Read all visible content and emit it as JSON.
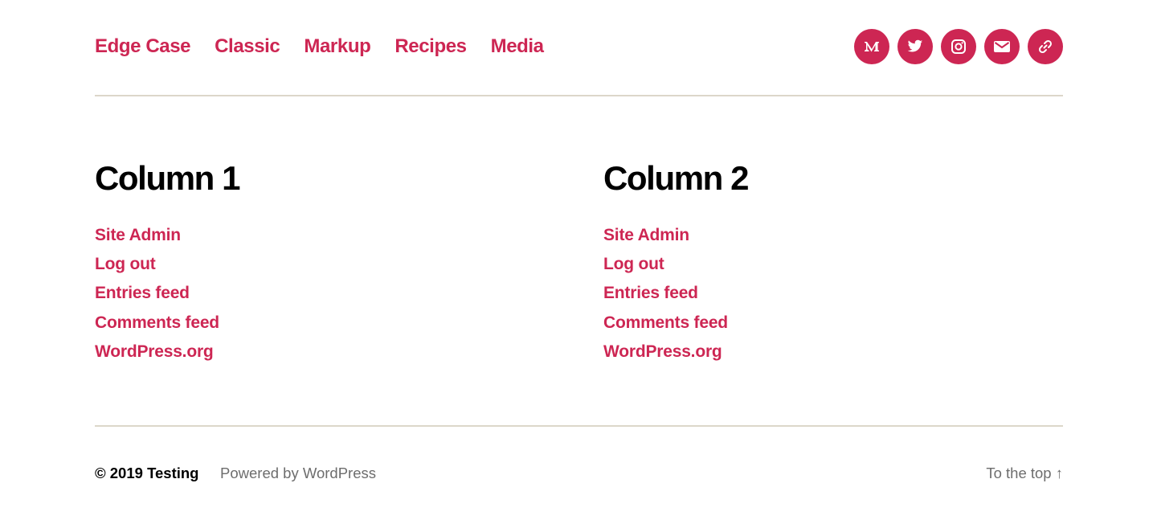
{
  "colors": {
    "accent": "#cd2653",
    "border": "#dcd7ca",
    "text": "#000000",
    "muted": "#6d6d6d"
  },
  "nav": {
    "items": [
      {
        "label": "Edge Case"
      },
      {
        "label": "Classic"
      },
      {
        "label": "Markup"
      },
      {
        "label": "Recipes"
      },
      {
        "label": "Media"
      }
    ],
    "social": [
      {
        "icon": "medium-icon"
      },
      {
        "icon": "twitter-icon"
      },
      {
        "icon": "instagram-icon"
      },
      {
        "icon": "mail-icon"
      },
      {
        "icon": "link-icon"
      }
    ]
  },
  "widgets": [
    {
      "title": "Column 1",
      "links": [
        "Site Admin",
        "Log out",
        "Entries feed",
        "Comments feed",
        "WordPress.org"
      ]
    },
    {
      "title": "Column 2",
      "links": [
        "Site Admin",
        "Log out",
        "Entries feed",
        "Comments feed",
        "WordPress.org"
      ]
    }
  ],
  "footer": {
    "copyright": "© 2019 Testing",
    "powered": "Powered by WordPress",
    "to_top": "To the top ↑"
  }
}
